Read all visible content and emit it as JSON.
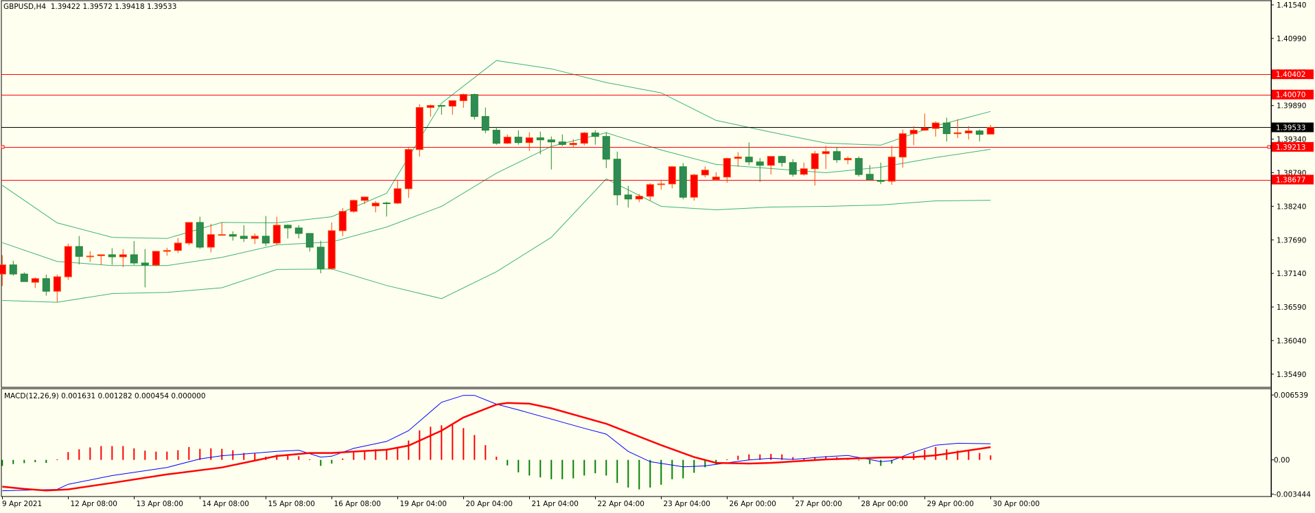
{
  "header": {
    "title": "GBPUSD,H4  1.39422 1.39572 1.39418 1.39533"
  },
  "macd_header": {
    "title": "MACD(12,26,9) 0.001631 0.001282 0.000454 0.000000"
  },
  "colors": {
    "background": "#fffff0",
    "bull_body": "#ff0000",
    "bull_edge": "#ff4500",
    "bear_body": "#2e8b57",
    "bear_edge": "#228b22",
    "bands": "#3cb371",
    "macd_line": "#0000ff",
    "signal_line": "#ff0000",
    "hist_pos": "#ff0000",
    "hist_neg": "#008000",
    "level_line": "#ff0000",
    "bid_line": "#000000"
  },
  "chart_data": {
    "type": "candlestick",
    "symbol": "GBPUSD",
    "timeframe": "H4",
    "ylim": [
      1.35274,
      1.41608
    ],
    "price_ticks": [
      "1.41540",
      "1.40990",
      "1.40440",
      "1.39890",
      "1.39340",
      "1.38790",
      "1.38240",
      "1.37690",
      "1.37140",
      "1.36590",
      "1.36040",
      "1.35490"
    ],
    "time_labels": [
      {
        "index": 0,
        "label": "9 Apr 2021"
      },
      {
        "index": 6,
        "label": "12 Apr 08:00"
      },
      {
        "index": 12,
        "label": "13 Apr 08:00"
      },
      {
        "index": 18,
        "label": "14 Apr 08:00"
      },
      {
        "index": 24,
        "label": "15 Apr 08:00"
      },
      {
        "index": 30,
        "label": "16 Apr 08:00"
      },
      {
        "index": 36,
        "label": "19 Apr 04:00"
      },
      {
        "index": 42,
        "label": "20 Apr 04:00"
      },
      {
        "index": 48,
        "label": "21 Apr 04:00"
      },
      {
        "index": 54,
        "label": "22 Apr 04:00"
      },
      {
        "index": 60,
        "label": "23 Apr 04:00"
      },
      {
        "index": 66,
        "label": "26 Apr 00:00"
      },
      {
        "index": 72,
        "label": "27 Apr 00:00"
      },
      {
        "index": 78,
        "label": "28 Apr 00:00"
      },
      {
        "index": 84,
        "label": "29 Apr 00:00"
      },
      {
        "index": 90,
        "label": "30 Apr 00:00"
      }
    ],
    "candles_ohlc": [
      [
        1.3713,
        1.37438,
        1.36934,
        1.3728
      ],
      [
        1.3728,
        1.37348,
        1.37103,
        1.3713
      ],
      [
        1.3713,
        1.37156,
        1.37006,
        1.37006
      ],
      [
        1.36995,
        1.37077,
        1.369,
        1.37055
      ],
      [
        1.37055,
        1.37122,
        1.36776,
        1.36848
      ],
      [
        1.36848,
        1.37122,
        1.36672,
        1.37085
      ],
      [
        1.37085,
        1.37629,
        1.37036,
        1.37581
      ],
      [
        1.37581,
        1.37753,
        1.37288,
        1.37419
      ],
      [
        1.37419,
        1.37505,
        1.37329,
        1.37424
      ],
      [
        1.3743,
        1.37449,
        1.3728,
        1.37446
      ],
      [
        1.37446,
        1.37551,
        1.3728,
        1.37412
      ],
      [
        1.37412,
        1.37539,
        1.37243,
        1.37446
      ],
      [
        1.37446,
        1.37671,
        1.3728,
        1.37311
      ],
      [
        1.37311,
        1.37539,
        1.36912,
        1.37277
      ],
      [
        1.37277,
        1.37502,
        1.37258,
        1.37502
      ],
      [
        1.37502,
        1.37562,
        1.3743,
        1.37516
      ],
      [
        1.37516,
        1.3772,
        1.37475,
        1.37637
      ],
      [
        1.37637,
        1.37975,
        1.37599,
        1.37975
      ],
      [
        1.37975,
        1.38069,
        1.37543,
        1.3757
      ],
      [
        1.3757,
        1.37953,
        1.37486,
        1.37776
      ],
      [
        1.37773,
        1.37975,
        1.37757,
        1.37776
      ],
      [
        1.37776,
        1.37829,
        1.37678,
        1.3775
      ],
      [
        1.3775,
        1.3793,
        1.37655,
        1.37712
      ],
      [
        1.37712,
        1.37795,
        1.37622,
        1.3775
      ],
      [
        1.3775,
        1.38081,
        1.37588,
        1.37637
      ],
      [
        1.37637,
        1.38069,
        1.3761,
        1.3793
      ],
      [
        1.3793,
        1.37942,
        1.37712,
        1.37885
      ],
      [
        1.37885,
        1.3793,
        1.37712,
        1.37795
      ],
      [
        1.37795,
        1.37795,
        1.37498,
        1.3757
      ],
      [
        1.3757,
        1.37675,
        1.37142,
        1.3722
      ],
      [
        1.3722,
        1.37975,
        1.37201,
        1.3784
      ],
      [
        1.3784,
        1.38212,
        1.3775,
        1.38156
      ],
      [
        1.38156,
        1.38351,
        1.38133,
        1.38336
      ],
      [
        1.38336,
        1.38392,
        1.38275,
        1.38392
      ],
      [
        1.38246,
        1.38325,
        1.3814,
        1.38291
      ],
      [
        1.38294,
        1.38314,
        1.38072,
        1.38291
      ],
      [
        1.38291,
        1.38666,
        1.38275,
        1.38528
      ],
      [
        1.38528,
        1.39215,
        1.38377,
        1.3917
      ],
      [
        1.3917,
        1.39914,
        1.39053,
        1.39858
      ],
      [
        1.39858,
        1.39906,
        1.39707,
        1.39891
      ],
      [
        1.39891,
        1.39898,
        1.3974,
        1.3988
      ],
      [
        1.3988,
        1.3997,
        1.3974,
        1.3997
      ],
      [
        1.3997,
        1.40086,
        1.39853,
        1.40072
      ],
      [
        1.40072,
        1.40086,
        1.39661,
        1.39711
      ],
      [
        1.39711,
        1.39858,
        1.39436,
        1.39486
      ],
      [
        1.39486,
        1.39542,
        1.39249,
        1.39272
      ],
      [
        1.39272,
        1.39418,
        1.3926,
        1.39373
      ],
      [
        1.39373,
        1.39486,
        1.39249,
        1.39283
      ],
      [
        1.39283,
        1.39452,
        1.39148,
        1.39362
      ],
      [
        1.39362,
        1.39463,
        1.39091,
        1.39328
      ],
      [
        1.39328,
        1.39384,
        1.38843,
        1.39294
      ],
      [
        1.39294,
        1.39418,
        1.39226,
        1.39252
      ],
      [
        1.39249,
        1.39339,
        1.39199,
        1.39272
      ],
      [
        1.39272,
        1.39459,
        1.39238,
        1.39441
      ],
      [
        1.39441,
        1.39486,
        1.39249,
        1.39384
      ],
      [
        1.39384,
        1.39452,
        1.38866,
        1.39012
      ],
      [
        1.39012,
        1.39136,
        1.38257,
        1.38426
      ],
      [
        1.38426,
        1.38576,
        1.38219,
        1.38359
      ],
      [
        1.38359,
        1.38441,
        1.38309,
        1.38404
      ],
      [
        1.38404,
        1.38618,
        1.38332,
        1.38595
      ],
      [
        1.38595,
        1.38658,
        1.38512,
        1.38606
      ],
      [
        1.38606,
        1.389,
        1.38534,
        1.38888
      ],
      [
        1.38888,
        1.38948,
        1.38354,
        1.38388
      ],
      [
        1.38388,
        1.38771,
        1.38332,
        1.38753
      ],
      [
        1.38753,
        1.38892,
        1.38715,
        1.38832
      ],
      [
        1.38678,
        1.38798,
        1.38658,
        1.38719
      ],
      [
        1.38719,
        1.39035,
        1.38625,
        1.39024
      ],
      [
        1.39024,
        1.39125,
        1.38888,
        1.39046
      ],
      [
        1.39046,
        1.39286,
        1.38914,
        1.38967
      ],
      [
        1.38967,
        1.3903,
        1.38636,
        1.38911
      ],
      [
        1.38911,
        1.39057,
        1.3876,
        1.39057
      ],
      [
        1.39057,
        1.39069,
        1.38888,
        1.38956
      ],
      [
        1.38956,
        1.39012,
        1.38726,
        1.38764
      ],
      [
        1.38764,
        1.38956,
        1.38742,
        1.38855
      ],
      [
        1.38855,
        1.39148,
        1.3858,
        1.39102
      ],
      [
        1.39102,
        1.3923,
        1.3885,
        1.39136
      ],
      [
        1.39136,
        1.39215,
        1.38951,
        1.39001
      ],
      [
        1.39001,
        1.39057,
        1.38929,
        1.39024
      ],
      [
        1.39024,
        1.39057,
        1.38726,
        1.3876
      ],
      [
        1.38764,
        1.38914,
        1.38678,
        1.38678
      ],
      [
        1.38666,
        1.38956,
        1.38602,
        1.38647
      ],
      [
        1.38651,
        1.3923,
        1.38591,
        1.39046
      ],
      [
        1.39046,
        1.39497,
        1.38873,
        1.39429
      ],
      [
        1.39429,
        1.39553,
        1.39241,
        1.39486
      ],
      [
        1.39486,
        1.39759,
        1.39474,
        1.39523
      ],
      [
        1.39515,
        1.39632,
        1.3938,
        1.39605
      ],
      [
        1.39605,
        1.39692,
        1.39301,
        1.39429
      ],
      [
        1.39429,
        1.39666,
        1.39357,
        1.39444
      ],
      [
        1.39441,
        1.39553,
        1.39335,
        1.39474
      ],
      [
        1.39474,
        1.395,
        1.39305,
        1.39418
      ],
      [
        1.39422,
        1.39572,
        1.39418,
        1.39533
      ]
    ],
    "bollinger": {
      "period": 20,
      "index": [
        0,
        5,
        10,
        15,
        20,
        25,
        30,
        35,
        40,
        45,
        50,
        55,
        60,
        65,
        70,
        75,
        80,
        85,
        90
      ],
      "upper": [
        1.38584,
        1.37968,
        1.37731,
        1.37712,
        1.37975,
        1.37968,
        1.38069,
        1.38452,
        1.39929,
        1.40627,
        1.40492,
        1.40267,
        1.40098,
        1.39647,
        1.39455,
        1.39275,
        1.39241,
        1.39557,
        1.39793
      ],
      "middle": [
        1.37644,
        1.37336,
        1.37269,
        1.37269,
        1.37404,
        1.37607,
        1.37655,
        1.379,
        1.38238,
        1.38782,
        1.39222,
        1.39444,
        1.39162,
        1.38926,
        1.38858,
        1.3879,
        1.3888,
        1.39038,
        1.39173
      ],
      "lower": [
        1.36697,
        1.36668,
        1.3681,
        1.36829,
        1.36905,
        1.37205,
        1.37212,
        1.36942,
        1.36728,
        1.37167,
        1.37731,
        1.38689,
        1.38238,
        1.38182,
        1.38227,
        1.38238,
        1.38261,
        1.38328,
        1.38339
      ]
    },
    "levels": [
      {
        "price": 1.40402,
        "label": "1.40402",
        "kind": "level"
      },
      {
        "price": 1.4007,
        "label": "1.40070",
        "kind": "level"
      },
      {
        "price": 1.39533,
        "label": "1.39533",
        "kind": "bid"
      },
      {
        "price": 1.39213,
        "label": "1.39213",
        "kind": "level",
        "markers": true
      },
      {
        "price": 1.38677,
        "label": "1.38677",
        "kind": "level"
      }
    ],
    "macd": {
      "params": "12,26,9",
      "ylim": [
        -0.003689,
        0.007169
      ],
      "axis_labels": [
        {
          "value": 0.006539,
          "label": "0.006539"
        },
        {
          "value": 0.0,
          "label": "0.00"
        },
        {
          "value": -0.003444,
          "label": "-0.003444"
        }
      ],
      "histogram": [
        -0.000603,
        -0.000418,
        -0.000325,
        -0.000232,
        -0.000302,
        4.6e-05,
        0.000789,
        0.001067,
        0.001253,
        0.001392,
        0.001392,
        0.001392,
        0.00116,
        0.000928,
        0.000835,
        0.000835,
        0.000974,
        0.001299,
        0.001114,
        0.00116,
        0.001114,
        0.000974,
        0.000696,
        0.00065,
        0.000325,
        0.00051,
        0.000464,
        0.000371,
        4.6e-05,
        -0.000603,
        -0.000371,
        0.000139,
        0.000742,
        0.000928,
        0.001067,
        0.001114,
        0.001206,
        0.001949,
        0.00297,
        0.003341,
        0.00348,
        0.003526,
        0.003202,
        0.002506,
        0.001485,
        0.000325,
        -0.000557,
        -0.001253,
        -0.001578,
        -0.001763,
        -0.001949,
        -0.001949,
        -0.001856,
        -0.001578,
        -0.001346,
        -0.001578,
        -0.00232,
        -0.002784,
        -0.00297,
        -0.002784,
        -0.002506,
        -0.001949,
        -0.001856,
        -0.001299,
        -0.000742,
        -0.000464,
        4.6e-05,
        0.000418,
        0.000557,
        0.000557,
        0.000603,
        0.000557,
        0.000278,
        0.000139,
        0.000278,
        0.000371,
        0.000278,
        0.000186,
        -4.6e-05,
        -0.000418,
        -0.000603,
        -0.000371,
        0.000186,
        0.000696,
        0.001021,
        0.001299,
        0.001067,
        0.000928,
        0.000928,
        0.000696,
        0.000454
      ],
      "macd_line": {
        "index": [
          0,
          5,
          6,
          10,
          15,
          18,
          20,
          25,
          27,
          29,
          30,
          32,
          35,
          37,
          40,
          42,
          43,
          45,
          47,
          50,
          53,
          55,
          57,
          59,
          62,
          64,
          66,
          68,
          70,
          72,
          75,
          77,
          79,
          80,
          81,
          83,
          85,
          87,
          90
        ],
        "values": [
          -0.003109,
          -0.00297,
          -0.002459,
          -0.001578,
          -0.000766,
          9.3e-05,
          0.000418,
          0.000858,
          0.000974,
          0.000278,
          0.000371,
          0.00116,
          0.001856,
          0.002946,
          0.0058,
          0.006496,
          0.006496,
          0.005614,
          0.005034,
          0.004106,
          0.003178,
          0.002598,
          0.000858,
          -0.000186,
          -0.000696,
          -0.000603,
          -0.000302,
          0.0,
          0.000162,
          4.6e-05,
          0.000325,
          0.000441,
          4.6e-05,
          -0.000186,
          -7e-05,
          0.000789,
          0.001485,
          0.00167,
          0.001631
        ]
      },
      "signal_line": {
        "index": [
          0,
          2,
          4,
          6,
          10,
          15,
          20,
          25,
          28,
          30,
          32,
          35,
          37,
          40,
          42,
          45,
          46,
          48,
          50,
          55,
          60,
          63,
          65,
          68,
          70,
          75,
          80,
          83,
          85,
          87,
          90
        ],
        "values": [
          -0.002691,
          -0.002923,
          -0.003086,
          -0.00297,
          -0.00232,
          -0.001462,
          -0.000766,
          0.000394,
          0.000696,
          0.000696,
          0.000835,
          0.001021,
          0.001438,
          0.002946,
          0.004269,
          0.005568,
          0.00573,
          0.005661,
          0.005197,
          0.003642,
          0.001485,
          0.000278,
          -0.000302,
          -0.000371,
          -0.000302,
          4.6e-05,
          0.000232,
          0.000278,
          0.000464,
          0.000789,
          0.001282
        ]
      }
    }
  }
}
